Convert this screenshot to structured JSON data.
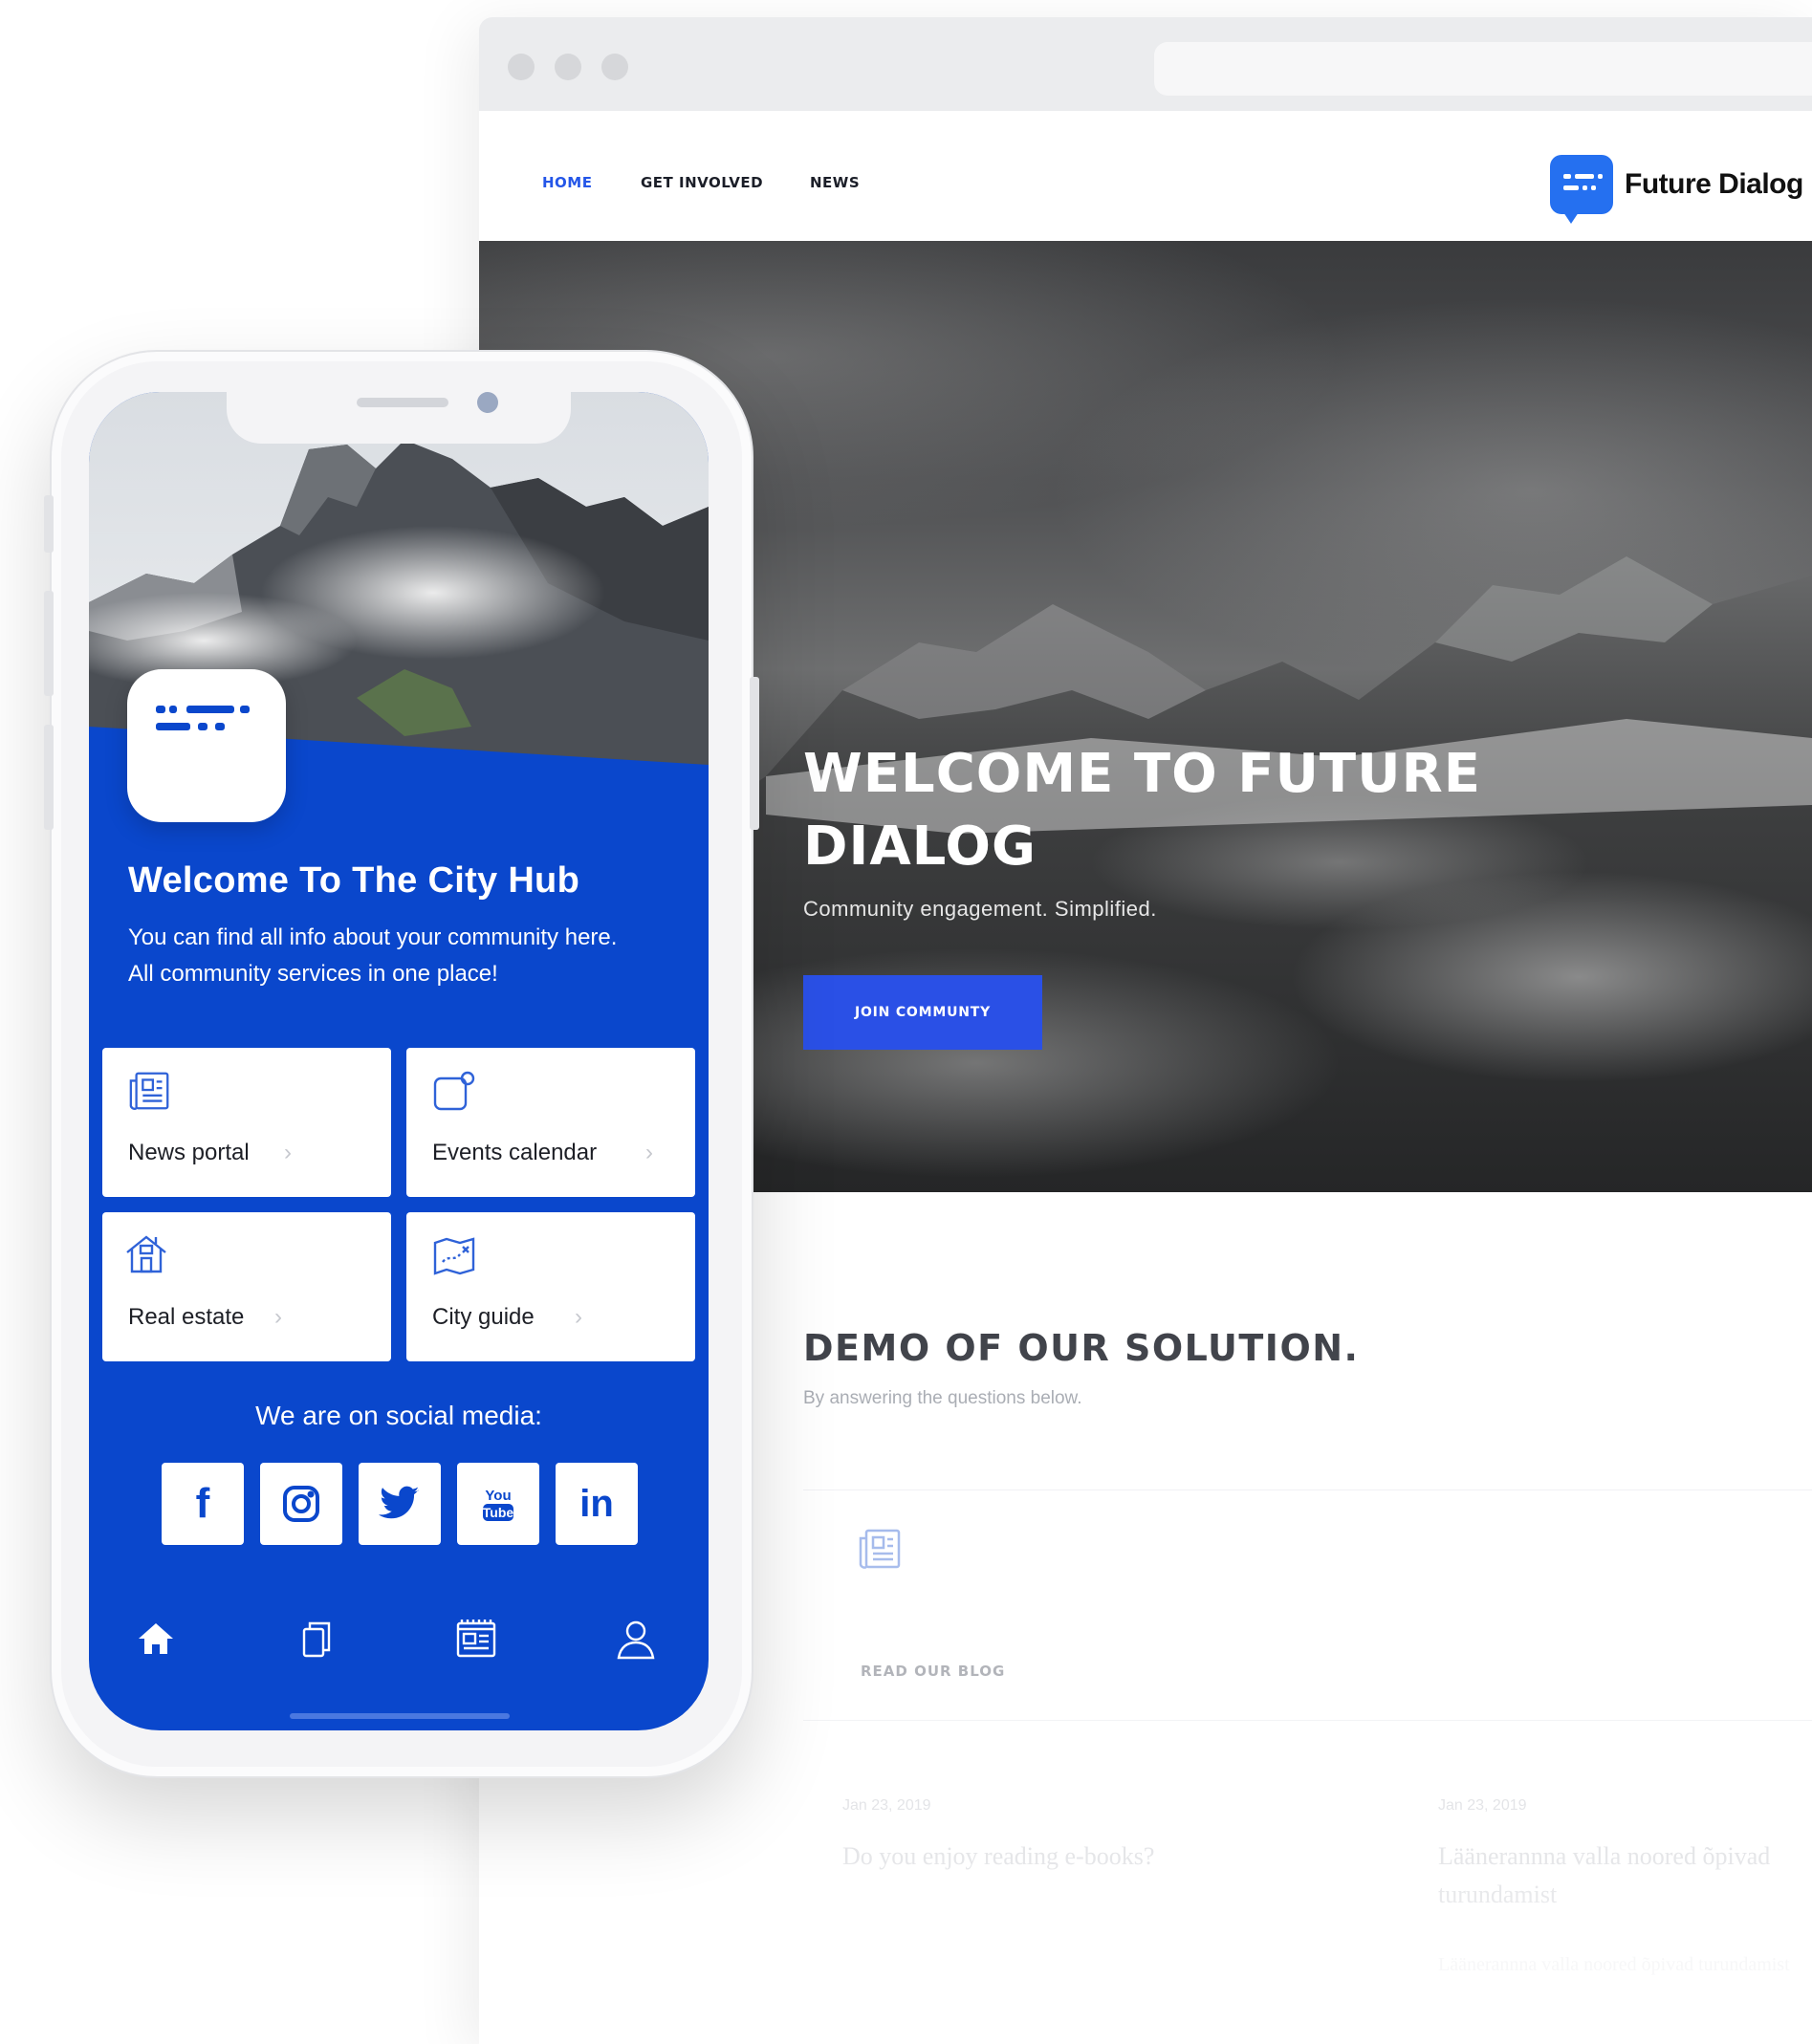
{
  "browser": {
    "nav": {
      "home": "HOME",
      "get_involved": "GET INVOLVED",
      "news": "NEWS"
    },
    "brand": {
      "name": "Future Dialog",
      "logo_icon": "chat-bubble-icon",
      "color": "#2570f0"
    },
    "hero": {
      "title": "WELCOME TO FUTURE DIALOG",
      "subtitle": "Community engagement. Simplified.",
      "button": "JOIN COMMUNTY"
    },
    "demo": {
      "title": "DEMO OF OUR SOLUTION.",
      "subtitle": "By answering the questions below.",
      "card_label": "READ OUR BLOG",
      "card_icon": "newspaper-icon"
    },
    "posts": [
      {
        "date": "Jan 23, 2019",
        "title": "Do you enjoy reading e-books?"
      },
      {
        "date": "Jan 23, 2019",
        "title": "Läänerannna valla noored õpivad turundamist",
        "excerpt": "Läänerannna valla noored õpivad turundamist"
      }
    ]
  },
  "phone": {
    "accent": "#0a47cc",
    "title": "Welcome To The City Hub",
    "description": "You can find all info about your community here. All community services in one place!",
    "tiles": [
      {
        "label": "News portal",
        "icon": "newspaper-icon"
      },
      {
        "label": "Events calendar",
        "icon": "calendar-icon"
      },
      {
        "label": "Real estate",
        "icon": "house-icon"
      },
      {
        "label": "City guide",
        "icon": "map-icon"
      }
    ],
    "social_title": "We are on social media:",
    "social": [
      {
        "name": "facebook-icon",
        "glyph": "f"
      },
      {
        "name": "instagram-icon",
        "glyph": ""
      },
      {
        "name": "twitter-icon",
        "glyph": ""
      },
      {
        "name": "youtube-icon",
        "glyph": "You Tube"
      },
      {
        "name": "linkedin-icon",
        "glyph": "in"
      }
    ],
    "tabbar": [
      "home-icon",
      "documents-icon",
      "news-icon",
      "profile-icon"
    ]
  }
}
